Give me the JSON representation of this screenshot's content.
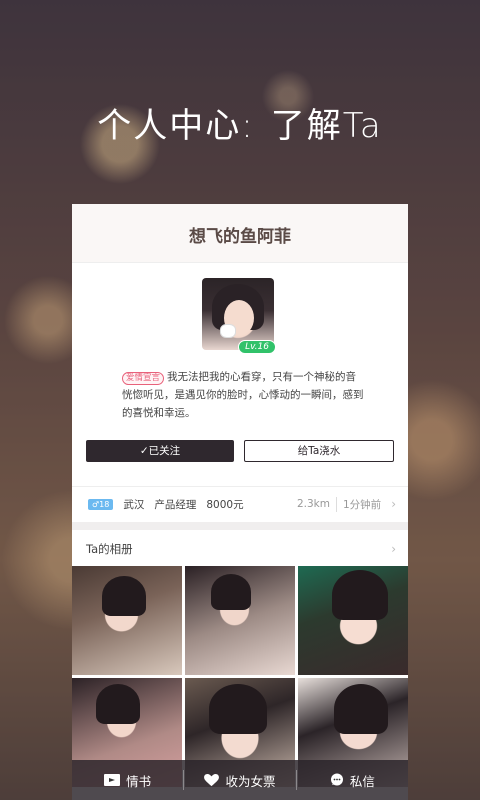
{
  "headline": {
    "part1": "个人中心:",
    "part2": "了解Ta"
  },
  "profile": {
    "name": "想飞的鱼阿菲",
    "level": "Lv.16",
    "tag": "爱情宣言",
    "bio": "我无法把我的心看穿，只有一个神秘的音恍惚听见，是遇见你的脸时，心悸动的一瞬间，感到的喜悦和幸运。",
    "follow_label": "✓已关注",
    "water_label": "给Ta浇水"
  },
  "info": {
    "gender_age": "♂18",
    "city": "武汉",
    "job": "产品经理",
    "salary": "8000元",
    "distance": "2.3km",
    "last_active": "1分钟前"
  },
  "album": {
    "title": "Ta的相册",
    "photos": [
      "photo-1",
      "photo-2",
      "photo-3",
      "photo-4",
      "photo-5",
      "photo-6"
    ]
  },
  "bottom_bar": {
    "letter": "情书",
    "collect": "收为女票",
    "message": "私信"
  },
  "colors": {
    "dark": "#2f282e",
    "level": "#31c26a",
    "tag": "#e8617a",
    "gender": "#6bb9f0"
  }
}
